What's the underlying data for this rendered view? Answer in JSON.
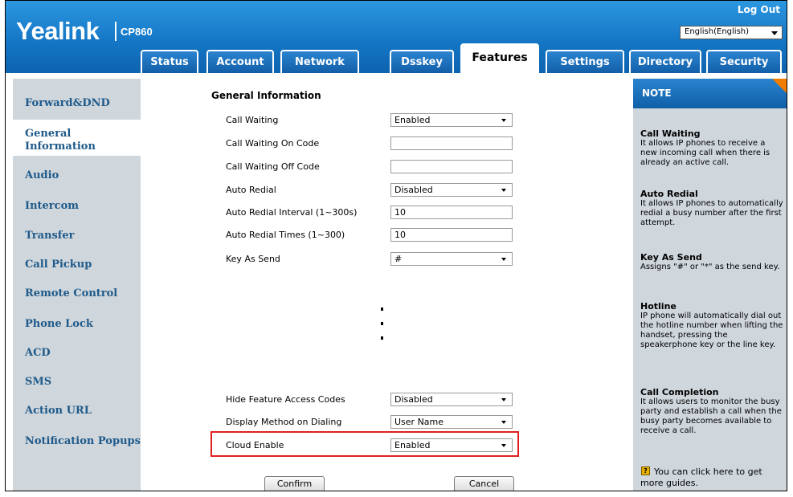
{
  "header": {
    "logo": "Yealink",
    "model": "CP860",
    "logout": "Log Out",
    "language": "English(English)"
  },
  "tabs": [
    {
      "label": "Status"
    },
    {
      "label": "Account"
    },
    {
      "label": "Network"
    },
    {
      "label": "Dsskey"
    },
    {
      "label": "Features",
      "active": true
    },
    {
      "label": "Settings"
    },
    {
      "label": "Directory"
    },
    {
      "label": "Security"
    }
  ],
  "sidebar": {
    "items": [
      {
        "label": "Forward&DND"
      },
      {
        "label": "General Information",
        "line1": "General",
        "line2": "Information",
        "active": true
      },
      {
        "label": "Audio"
      },
      {
        "label": "Intercom"
      },
      {
        "label": "Transfer"
      },
      {
        "label": "Call Pickup"
      },
      {
        "label": "Remote Control"
      },
      {
        "label": "Phone Lock"
      },
      {
        "label": "ACD"
      },
      {
        "label": "SMS"
      },
      {
        "label": "Action URL"
      },
      {
        "label": "Notification Popups"
      }
    ]
  },
  "main": {
    "section_title": "General Information",
    "rows": [
      {
        "label": "Call Waiting",
        "type": "select",
        "value": "Enabled"
      },
      {
        "label": "Call Waiting On Code",
        "type": "input",
        "value": ""
      },
      {
        "label": "Call Waiting Off Code",
        "type": "input",
        "value": ""
      },
      {
        "label": "Auto Redial",
        "type": "select",
        "value": "Disabled"
      },
      {
        "label": "Auto Redial Interval (1~300s)",
        "type": "input",
        "value": "10"
      },
      {
        "label": "Auto Redial Times (1~300)",
        "type": "input",
        "value": "10"
      },
      {
        "label": "Key As Send",
        "type": "select",
        "value": "#"
      },
      {
        "label": "Hide Feature Access Codes",
        "type": "select",
        "value": "Disabled"
      },
      {
        "label": "Display Method on Dialing",
        "type": "select",
        "value": "User Name"
      },
      {
        "label": "Cloud Enable",
        "type": "select",
        "value": "Enabled"
      }
    ],
    "confirm": "Confirm",
    "cancel": "Cancel"
  },
  "note": {
    "title": "NOTE",
    "entries": [
      {
        "title": "Call Waiting",
        "text": "It allows IP phones to receive a new incoming call when there is already an active call."
      },
      {
        "title": "Auto Redial",
        "text": "It allows IP phones to automatically redial a busy number after the first attempt."
      },
      {
        "title": "Key As Send",
        "text": "Assigns \"#\" or \"*\" as the send key."
      },
      {
        "title": "Hotline",
        "text": "IP phone will automatically dial out the hotline number when lifting the handset, pressing the speakerphone key or the line key."
      },
      {
        "title": "Call Completion",
        "text": "It allows users to monitor the busy party and establish a call when the busy party becomes available to receive a call."
      }
    ],
    "guide_text": "You can click here to get more guides.",
    "guide_icon": "book-icon"
  },
  "colors": {
    "header_blue": "#1577c6",
    "panel_gray": "#cfd6dc",
    "sidebar_text": "#1f5a8a",
    "note_corner": "#f07d00",
    "highlight": "#e02020"
  }
}
